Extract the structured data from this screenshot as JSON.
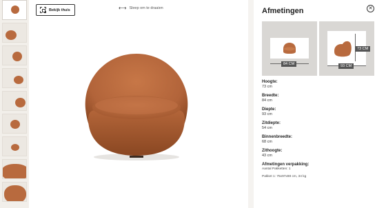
{
  "viewer": {
    "ar_button_label": "Bekijk thuis",
    "drag_hint": "Sleep om te draaien"
  },
  "panel": {
    "title": "Afmetingen",
    "front_view_label": "84 CM",
    "side_view_width_label": "93 CM",
    "side_view_height_label": "73 CM",
    "specs": [
      {
        "label": "Hoogte:",
        "value": "73 cm"
      },
      {
        "label": "Breedte:",
        "value": "84 cm"
      },
      {
        "label": "Diepte:",
        "value": "93 cm"
      },
      {
        "label": "Zitdiepte:",
        "value": "54 cm"
      },
      {
        "label": "Binnenbreedte:",
        "value": "68 cm"
      },
      {
        "label": "Zithoogte:",
        "value": "43 cm"
      }
    ],
    "packaging": {
      "label": "Afmetingen verpakking:",
      "count": "Aantal Pakketten: 1",
      "package": "Pakket 1: 75x97x88 cm, 34 kg"
    }
  },
  "colors": {
    "upholstery": "#b86a3e",
    "upholstery_dark": "#8f4b25",
    "panel_bg": "#ffffff",
    "rail_bg": "#f2efea"
  },
  "icons": [
    "view-in-room-icon",
    "rotate-arrows-icon",
    "close-icon"
  ]
}
